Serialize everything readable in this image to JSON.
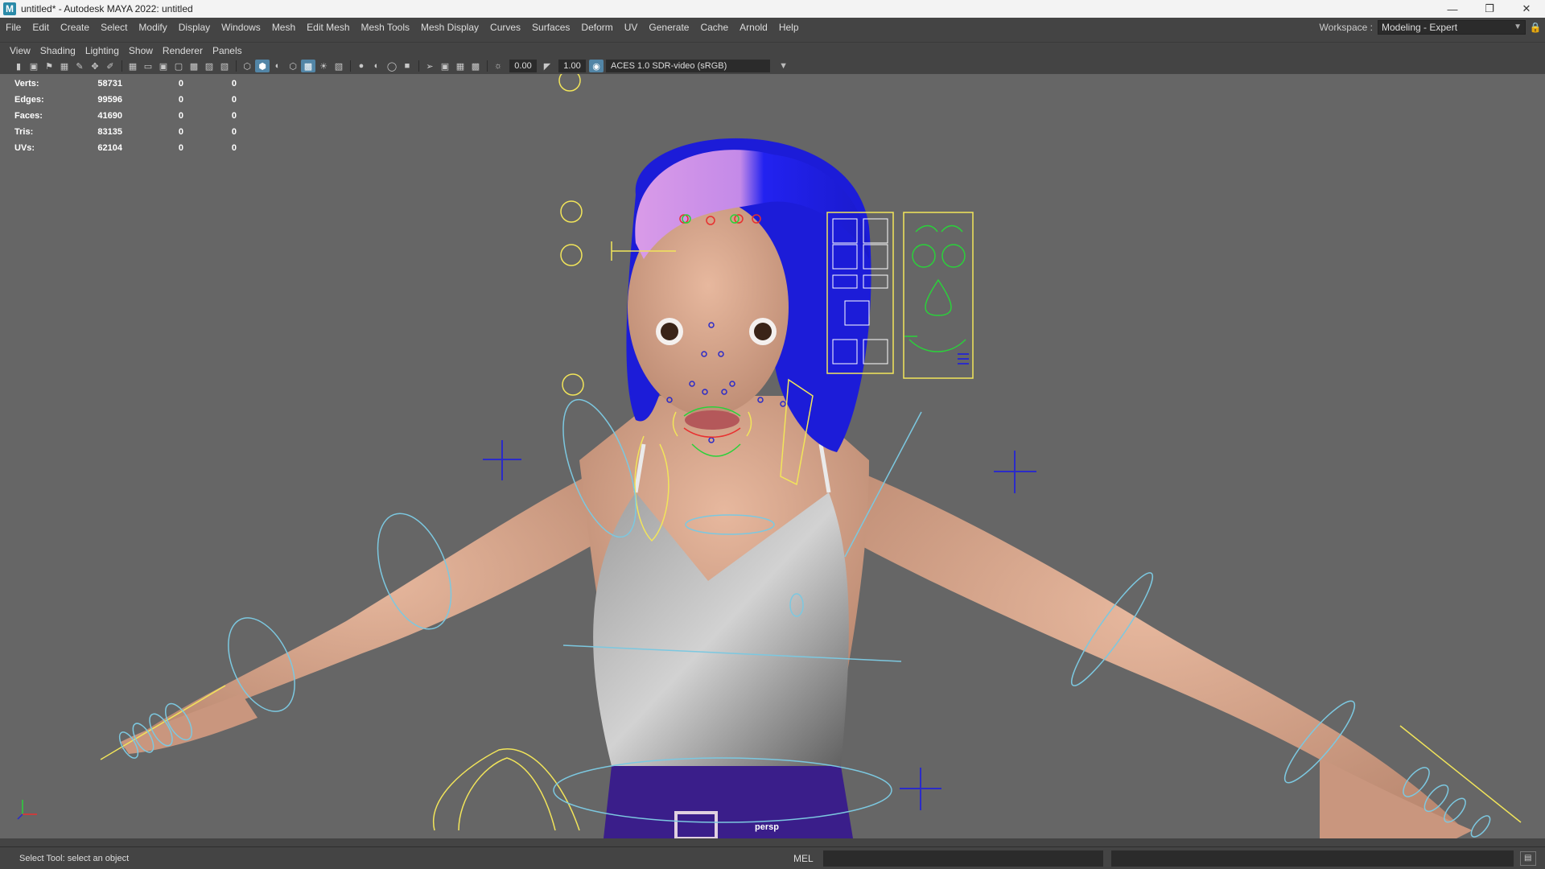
{
  "window": {
    "title": "untitled* - Autodesk MAYA 2022: untitled",
    "app_icon": "M",
    "controls": [
      "minimize-icon",
      "restore-icon",
      "close-icon"
    ]
  },
  "menubar": {
    "items": [
      "File",
      "Edit",
      "Create",
      "Select",
      "Modify",
      "Display",
      "Windows",
      "Mesh",
      "Edit Mesh",
      "Mesh Tools",
      "Mesh Display",
      "Curves",
      "Surfaces",
      "Deform",
      "UV",
      "Generate",
      "Cache",
      "Arnold",
      "Help"
    ]
  },
  "workspace": {
    "label": "Workspace :",
    "value": "Modeling - Expert"
  },
  "panel_menu": {
    "items": [
      "View",
      "Shading",
      "Lighting",
      "Show",
      "Renderer",
      "Panels"
    ]
  },
  "panel_toolbar": {
    "exposure": "0.00",
    "gamma": "1.00",
    "color_space": "ACES 1.0 SDR-video (sRGB)"
  },
  "hud": {
    "rows": [
      {
        "label": "Verts:",
        "v1": "58731",
        "v2": "0",
        "v3": "0"
      },
      {
        "label": "Edges:",
        "v1": "99596",
        "v2": "0",
        "v3": "0"
      },
      {
        "label": "Faces:",
        "v1": "41690",
        "v2": "0",
        "v3": "0"
      },
      {
        "label": "Tris:",
        "v1": "83135",
        "v2": "0",
        "v3": "0"
      },
      {
        "label": "UVs:",
        "v1": "62104",
        "v2": "0",
        "v3": "0"
      }
    ]
  },
  "viewport": {
    "camera": "persp",
    "background_color": "#666666",
    "hair_color_top": "#d69be6",
    "hair_color": "#1a1aee",
    "skin_color": "#d9a88e",
    "shirt_color": "#c8c8c8",
    "pants_color": "#3a1e8a",
    "control_yellow": "#f2e55a",
    "control_cyan": "#7cc8e0",
    "control_blue": "#2b2bc8",
    "control_green": "#2ad23a",
    "control_red": "#e83030"
  },
  "statusbar": {
    "help_line": "Select Tool: select an object",
    "mel_label": "MEL"
  }
}
